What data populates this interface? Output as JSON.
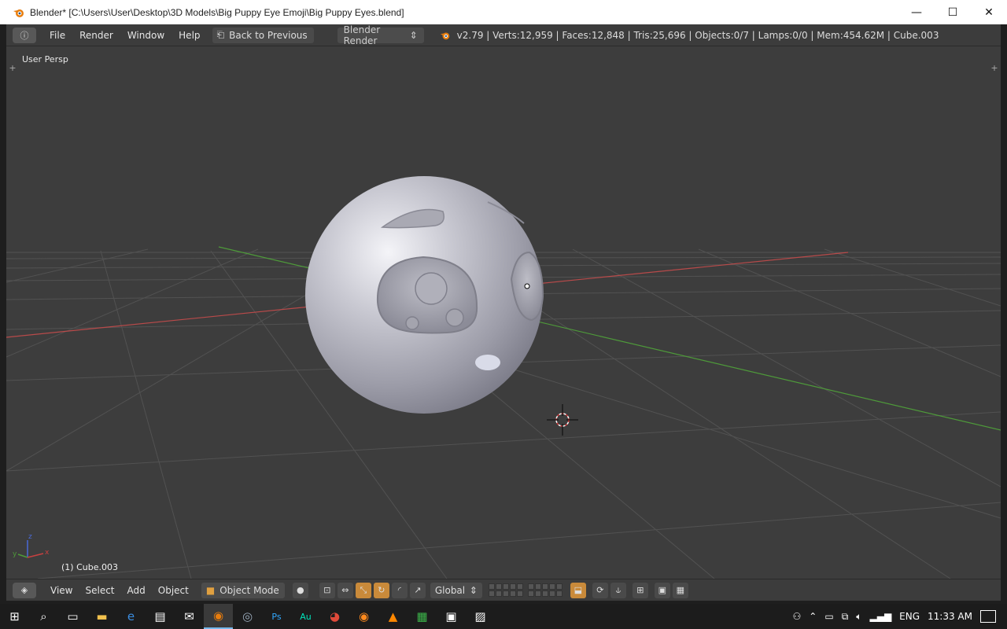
{
  "window": {
    "title": "Blender* [C:\\Users\\User\\Desktop\\3D Models\\Big Puppy Eye Emoji\\Big Puppy Eyes.blend]",
    "minimize": "—",
    "maximize": "☐",
    "close": "✕"
  },
  "info_header": {
    "menus": [
      "File",
      "Render",
      "Window",
      "Help"
    ],
    "back_button": "Back to Previous",
    "render_engine": "Blender Render",
    "stats": "v2.79 | Verts:12,959 | Faces:12,848 | Tris:25,696 | Objects:0/7 | Lamps:0/0 | Mem:454.62M | Cube.003"
  },
  "viewport": {
    "view_label": "User Persp",
    "object_label": "(1) Cube.003"
  },
  "view_header": {
    "menus": [
      "View",
      "Select",
      "Add",
      "Object"
    ],
    "mode": "Object Mode",
    "orientation": "Global"
  },
  "taskbar": {
    "language": "ENG",
    "time": "11:33 AM"
  },
  "colors": {
    "accent": "#c98a3a",
    "viewport_bg": "#3d3d3d",
    "x_axis": "#b84a4a",
    "y_axis": "#4e9a3a"
  }
}
